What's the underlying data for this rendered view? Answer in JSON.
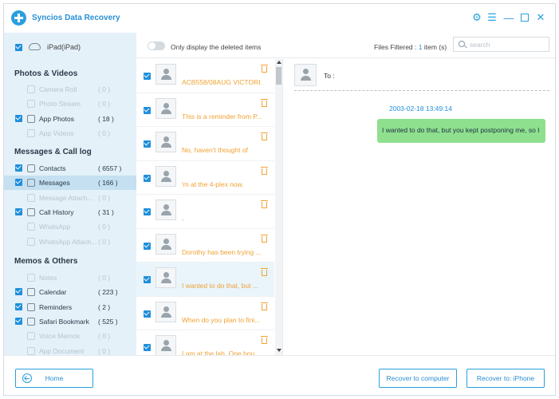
{
  "app": {
    "title": "Syncios Data Recovery"
  },
  "device": {
    "name": "iPad(iPad)"
  },
  "sections": [
    {
      "title": "Photos & Videos",
      "items": [
        {
          "label": "Camera Roll",
          "count": "( 0 )",
          "checked": false,
          "enabled": false,
          "icon": "camera-roll-icon"
        },
        {
          "label": "Photo Stream",
          "count": "( 0 )",
          "checked": false,
          "enabled": false,
          "icon": "photo-stream-icon"
        },
        {
          "label": "App Photos",
          "count": "( 18 )",
          "checked": true,
          "enabled": true,
          "icon": "app-photos-icon"
        },
        {
          "label": "App Videos",
          "count": "( 0 )",
          "checked": false,
          "enabled": false,
          "icon": "app-videos-icon"
        }
      ]
    },
    {
      "title": "Messages & Call log",
      "items": [
        {
          "label": "Contacts",
          "count": "( 6557 )",
          "checked": true,
          "enabled": true,
          "icon": "contacts-icon"
        },
        {
          "label": "Messages",
          "count": "( 166 )",
          "checked": true,
          "enabled": true,
          "selected": true,
          "icon": "messages-icon"
        },
        {
          "label": "Message Attach...",
          "count": "( 0 )",
          "checked": false,
          "enabled": false,
          "icon": "attachment-icon"
        },
        {
          "label": "Call History",
          "count": "( 31 )",
          "checked": true,
          "enabled": true,
          "icon": "call-history-icon"
        },
        {
          "label": "WhatsApp",
          "count": "( 0 )",
          "checked": false,
          "enabled": false,
          "icon": "whatsapp-icon"
        },
        {
          "label": "WhatsApp Attach...",
          "count": "( 0 )",
          "checked": false,
          "enabled": false,
          "icon": "whatsapp-attachment-icon"
        }
      ]
    },
    {
      "title": "Memos & Others",
      "items": [
        {
          "label": "Notes",
          "count": "( 0 )",
          "checked": false,
          "enabled": false,
          "icon": "notes-icon"
        },
        {
          "label": "Calendar",
          "count": "( 223 )",
          "checked": true,
          "enabled": true,
          "icon": "calendar-icon"
        },
        {
          "label": "Reminders",
          "count": "( 2 )",
          "checked": true,
          "enabled": true,
          "icon": "reminders-icon"
        },
        {
          "label": "Safari Bookmark",
          "count": "( 525 )",
          "checked": true,
          "enabled": true,
          "icon": "bookmark-icon"
        },
        {
          "label": "Voice Memos",
          "count": "( 0 )",
          "checked": false,
          "enabled": false,
          "icon": "voice-memos-icon"
        },
        {
          "label": "App Document",
          "count": "( 0 )",
          "checked": false,
          "enabled": false,
          "icon": "app-document-icon"
        }
      ]
    }
  ],
  "filter": {
    "toggle_label": "Only display the deleted items",
    "filtered_prefix": "Files Filtered : ",
    "filtered_count": "1",
    "filtered_suffix": " item (s)",
    "search_placeholder": "search"
  },
  "messages": [
    {
      "text": "ACB558/08AUG VICTORI...",
      "checked": true
    },
    {
      "text": "This is a reminder from P...",
      "checked": true
    },
    {
      "text": "No, haven't thought of",
      "checked": true
    },
    {
      "text": "'m at the 4-plex now.",
      "checked": true
    },
    {
      "text": ",",
      "checked": true
    },
    {
      "text": "Dorothy has been trying ...",
      "checked": true
    },
    {
      "text": "I wanted to do that, but ...",
      "checked": true,
      "selected": true
    },
    {
      "text": "When do you plan to fini...",
      "checked": true
    },
    {
      "text": "I am at the lab. One hou...",
      "checked": true
    }
  ],
  "detail": {
    "to_label": "To :",
    "timestamp": "2003-02-18 13:49:14",
    "bubble_text": "I wanted to do that, but you kept postponing me, so I"
  },
  "buttons": {
    "home": "Home",
    "recover_computer": "Recover to computer",
    "recover_iphone": "Recover to: iPhone"
  },
  "colors": {
    "accent": "#2a9fe0",
    "sidebar_bg": "#e4f1f9",
    "message_text": "#f0a233",
    "bubble": "#8ee08e"
  }
}
